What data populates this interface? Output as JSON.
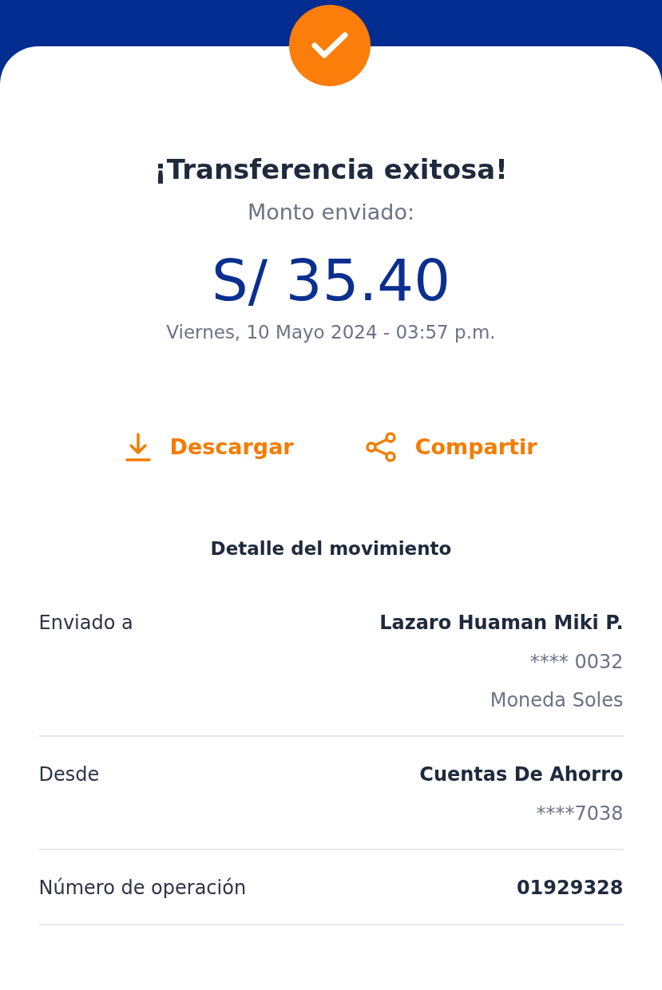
{
  "title": "¡Transferencia exitosa!",
  "amount_label": "Monto enviado:",
  "amount": "S/ 35.40",
  "datetime": "Viernes, 10 Mayo 2024 - 03:57 p.m.",
  "actions": [
    {
      "kind": "download",
      "label": "Descargar"
    },
    {
      "kind": "share",
      "label": "Compartir"
    }
  ],
  "detail_title": "Detalle del movimiento",
  "details": [
    {
      "label": "Enviado a",
      "primary": "Lazaro Huaman Miki P.",
      "secondary": [
        "**** 0032",
        "Moneda Soles"
      ]
    },
    {
      "label": "Desde",
      "primary": "Cuentas De Ahorro",
      "secondary": [
        "****7038"
      ]
    },
    {
      "label": "Número de operación",
      "primary": "01929328"
    }
  ]
}
